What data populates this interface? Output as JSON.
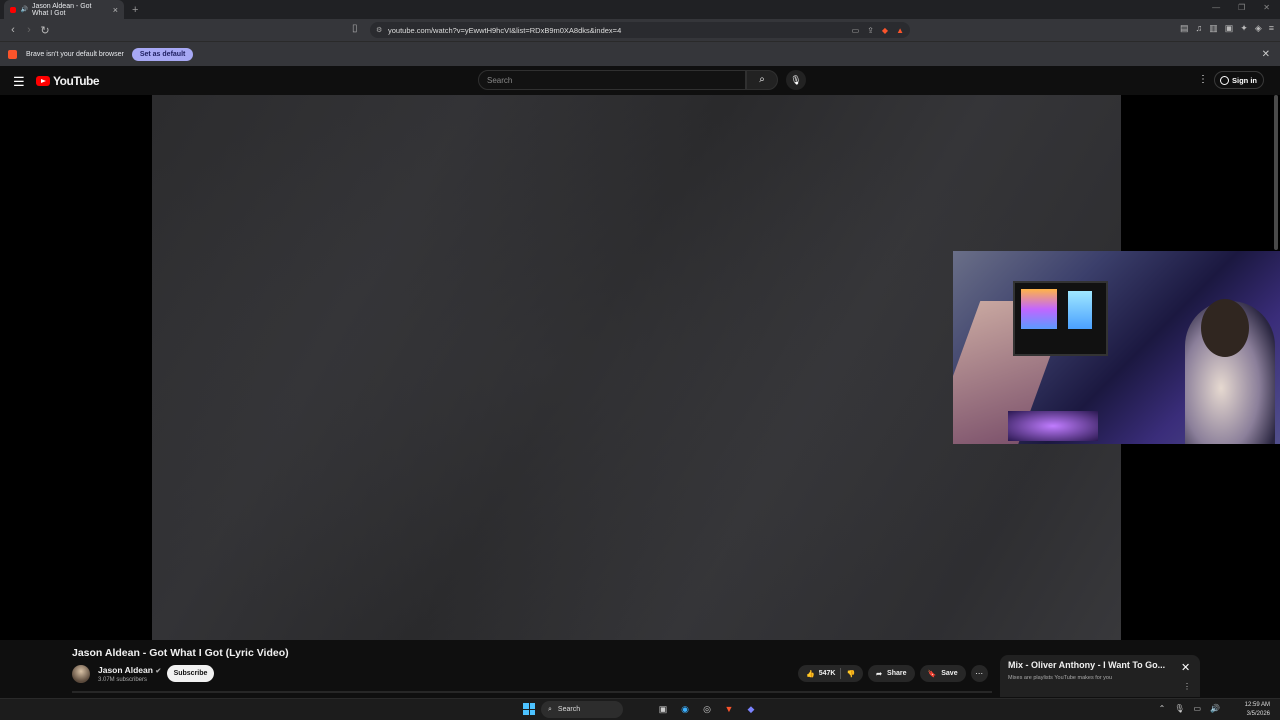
{
  "browser": {
    "tab_title": "Jason Aldean - Got What I Got",
    "new_tab": "+",
    "url": "youtube.com/watch?v=yEwwtH9hcVI&list=RDxB9m0XA8dks&index=4",
    "infobar_text": "Brave isn't your default browser",
    "set_default_label": "Set as default"
  },
  "youtube": {
    "logo_text": "YouTube",
    "search_placeholder": "Search",
    "sign_in": "Sign in"
  },
  "video": {
    "title": "Jason Aldean - Got What I Got (Lyric Video)",
    "channel": "Jason Aldean",
    "subscribers": "3.07M subscribers",
    "subscribe_label": "Subscribe",
    "likes": "547K",
    "share_label": "Share",
    "save_label": "Save"
  },
  "mix": {
    "title": "Mix - Oliver Anthony - I Want To Go...",
    "subtitle": "Mixes are playlists YouTube makes for you"
  },
  "taskbar": {
    "search_label": "Search",
    "time": "12:59 AM",
    "date": "3/5/2026"
  },
  "colors": {
    "yt_red": "#ff0000",
    "brave_orange": "#fb542b",
    "set_default_bg": "#a7a8f4"
  }
}
